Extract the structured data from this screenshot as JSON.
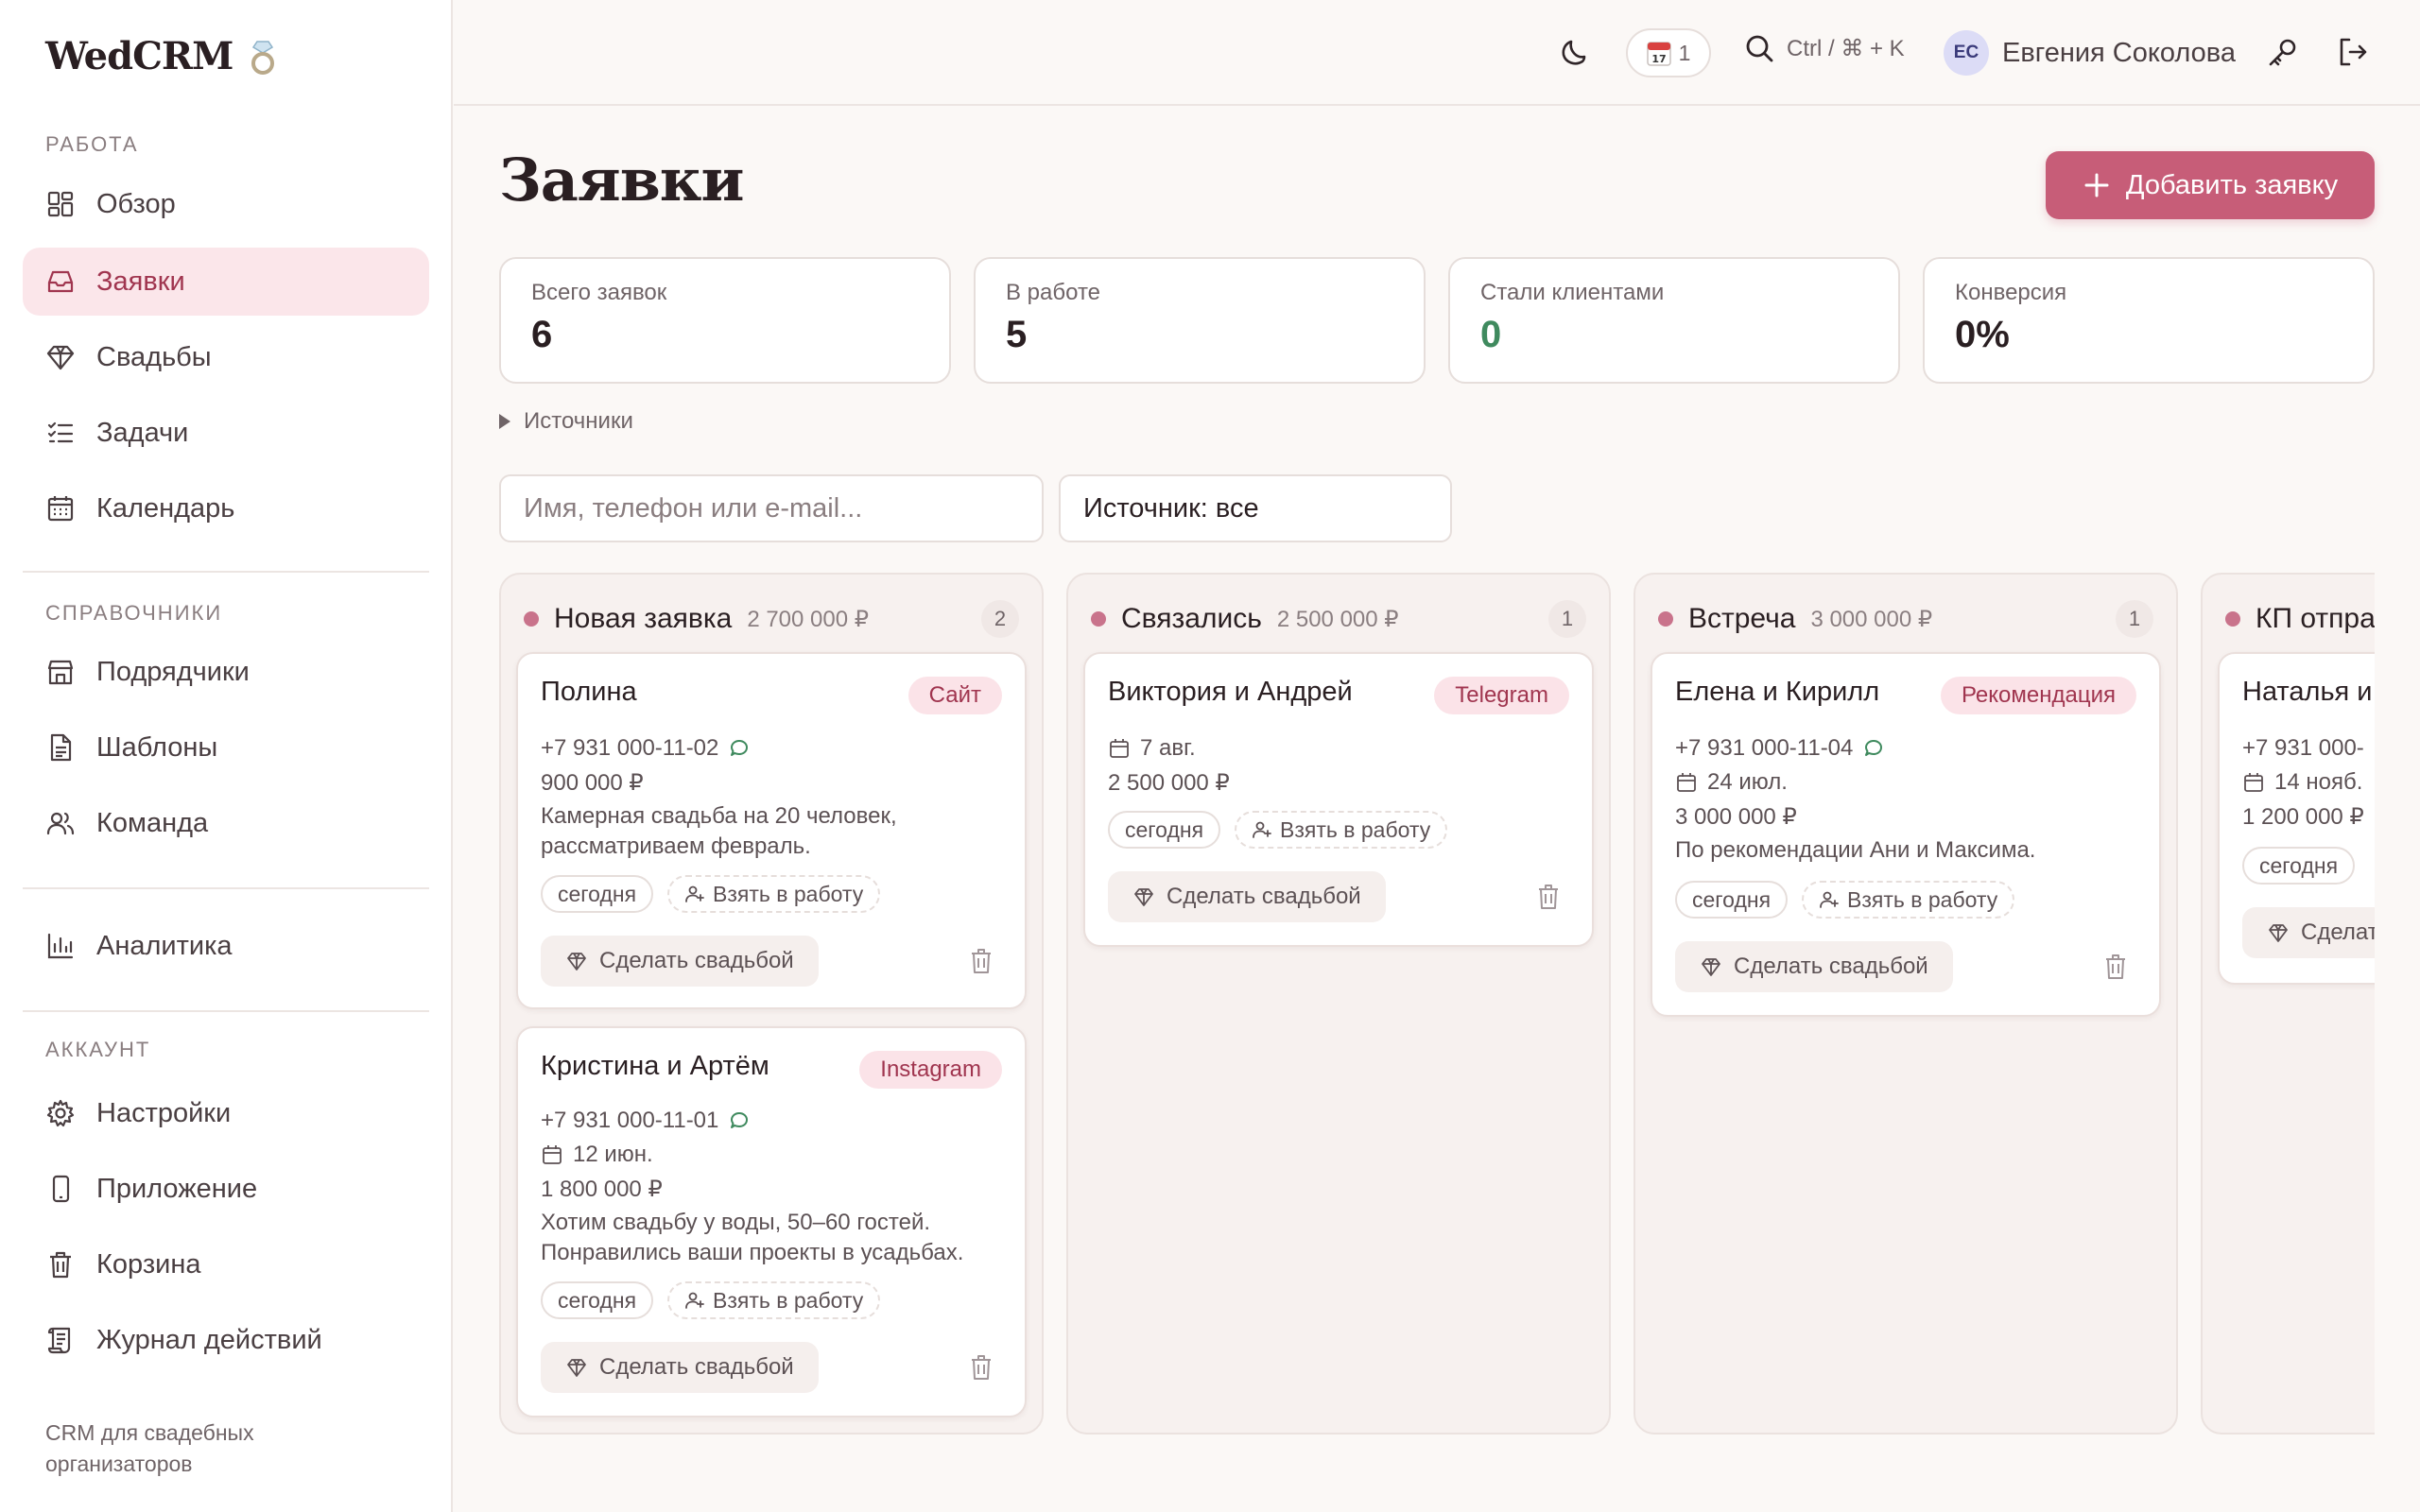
{
  "app": {
    "name": "WedCRM"
  },
  "sidebar": {
    "sections": {
      "work": "РАБОТА",
      "refs": "СПРАВОЧНИКИ",
      "account": "АККАУНТ"
    },
    "items": {
      "overview": "Обзор",
      "leads": "Заявки",
      "weddings": "Свадьбы",
      "tasks": "Задачи",
      "calendar": "Календарь",
      "vendors": "Подрядчики",
      "templates": "Шаблоны",
      "team": "Команда",
      "analytics": "Аналитика",
      "settings": "Настройки",
      "app": "Приложение",
      "trash": "Корзина",
      "log": "Журнал действий"
    },
    "active_item": "leads",
    "footer": "CRM для свадебных организаторов"
  },
  "topbar": {
    "calendar_count": "1",
    "search_shortcut": "Ctrl / ⌘ + K",
    "user_initials": "ЕС",
    "user_name": "Евгения Соколова"
  },
  "page": {
    "title": "Заявки",
    "add_button": "Добавить заявку"
  },
  "stats": [
    {
      "label": "Всего заявок",
      "value": "6"
    },
    {
      "label": "В работе",
      "value": "5"
    },
    {
      "label": "Стали клиентами",
      "value": "0"
    },
    {
      "label": "Конверсия",
      "value": "0%"
    }
  ],
  "filters": {
    "sources_toggle": "Источники",
    "search_placeholder": "Имя, телефон или e-mail...",
    "source_select": "Источник: все"
  },
  "labels": {
    "today": "сегодня",
    "take": "Взять в работу",
    "make_wedding": "Сделать свадьбой"
  },
  "columns": [
    {
      "name": "Новая заявка",
      "sum": "2 700 000 ₽",
      "count": "2",
      "cards": [
        {
          "name": "Полина",
          "badge": "Сайт",
          "phone": "+7 931 000-11-02",
          "amount": "900 000 ₽",
          "note1": "Камерная свадьба на 20 человек,",
          "note2": "рассматриваем февраль."
        },
        {
          "name": "Кристина и Артём",
          "badge": "Instagram",
          "phone": "+7 931 000-11-01",
          "date": "12 июн.",
          "amount": "1 800 000 ₽",
          "note1": "Хотим свадьбу у воды, 50–60 гостей.",
          "note2": "Понравились ваши проекты в усадьбах."
        }
      ]
    },
    {
      "name": "Связались",
      "sum": "2 500 000 ₽",
      "count": "1",
      "cards": [
        {
          "name": "Виктория и Андрей",
          "badge": "Telegram",
          "date": "7 авг.",
          "amount": "2 500 000 ₽"
        }
      ]
    },
    {
      "name": "Встреча",
      "sum": "3 000 000 ₽",
      "count": "1",
      "cards": [
        {
          "name": "Елена и Кирилл",
          "badge": "Рекомендация",
          "phone": "+7 931 000-11-04",
          "date": "24 июл.",
          "amount": "3 000 000 ₽",
          "note1": "По рекомендации Ани и Максима."
        }
      ]
    },
    {
      "name": "КП отпра",
      "cards": [
        {
          "name": "Наталья и",
          "phone": "+7 931 000-",
          "date": "14 нояб.",
          "amount": "1 200 000 ₽",
          "make_wedding_partial": "Сделат"
        }
      ]
    }
  ],
  "colors": {
    "accent": "#c75d78",
    "accent_soft": "#fbe6ea",
    "success": "#3f8a5e"
  }
}
